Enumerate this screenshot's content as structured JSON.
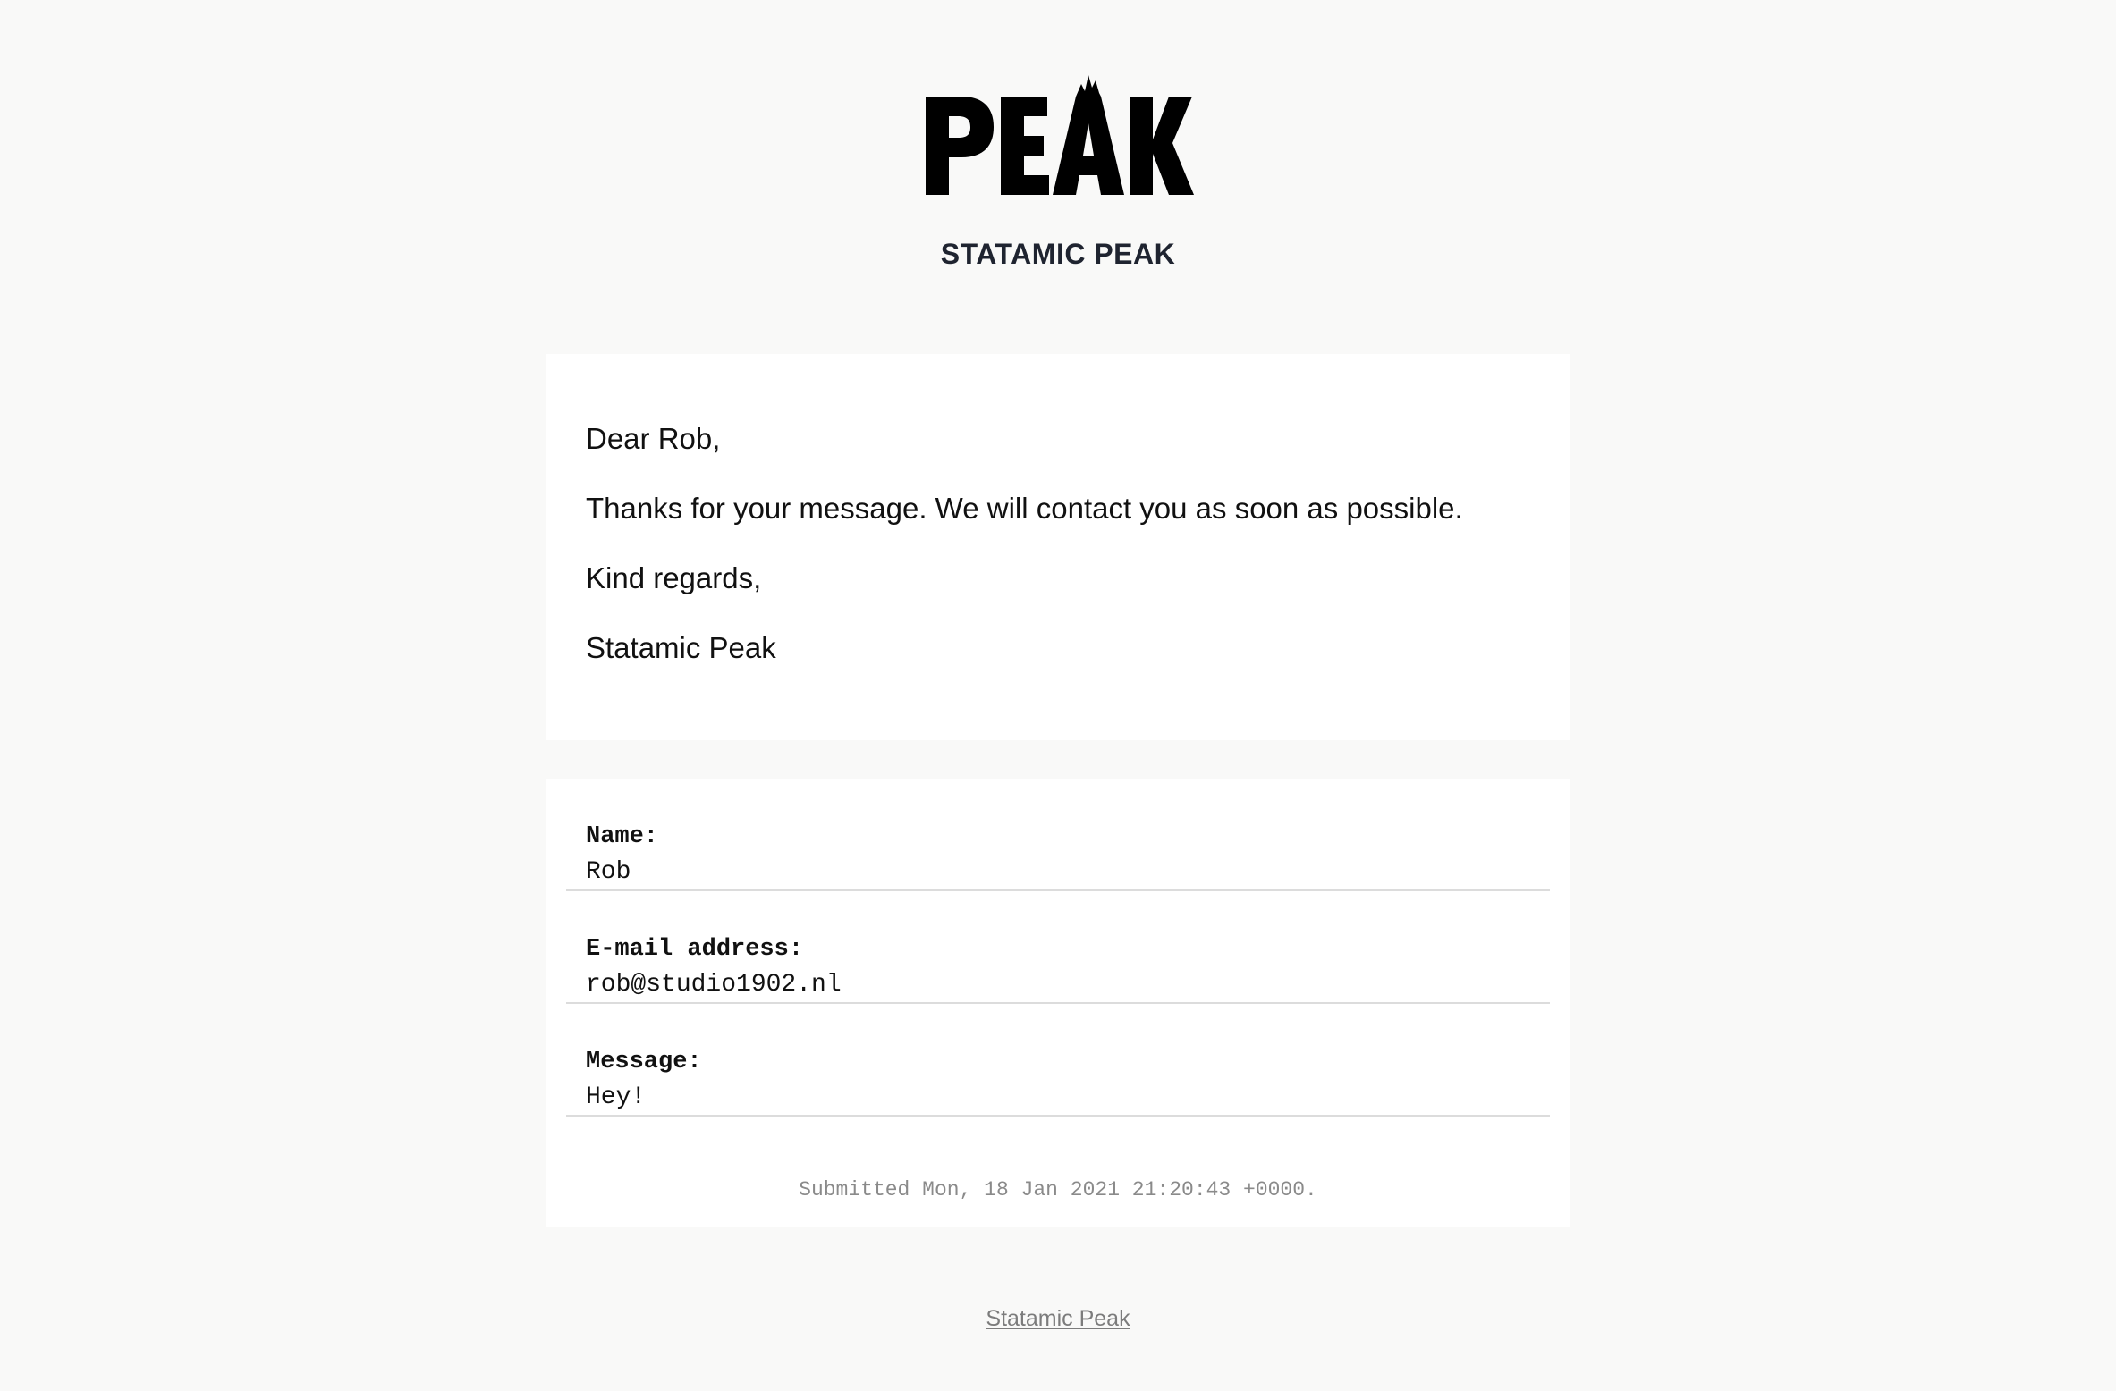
{
  "logo": {
    "text": "PEAK",
    "icon": "mountain-peak-logo"
  },
  "header": {
    "site_name": "STATAMIC PEAK"
  },
  "message": {
    "greeting": "Dear Rob,",
    "body": "Thanks for your message. We will contact you as soon as possible.",
    "closing": "Kind regards,",
    "signature": "Statamic Peak"
  },
  "fields": [
    {
      "label": "Name:",
      "value": "Rob"
    },
    {
      "label": "E-mail address:",
      "value": "rob@studio1902.nl"
    },
    {
      "label": "Message:",
      "value": "Hey!"
    }
  ],
  "submitted": "Submitted Mon, 18 Jan 2021 21:20:43 +0000.",
  "footer": {
    "link_text": "Statamic Peak"
  },
  "colors": {
    "background": "#f9f9f8",
    "card": "#ffffff",
    "heading": "#1f2430",
    "muted": "#8a8a8a",
    "divider": "#dcdcdc"
  }
}
